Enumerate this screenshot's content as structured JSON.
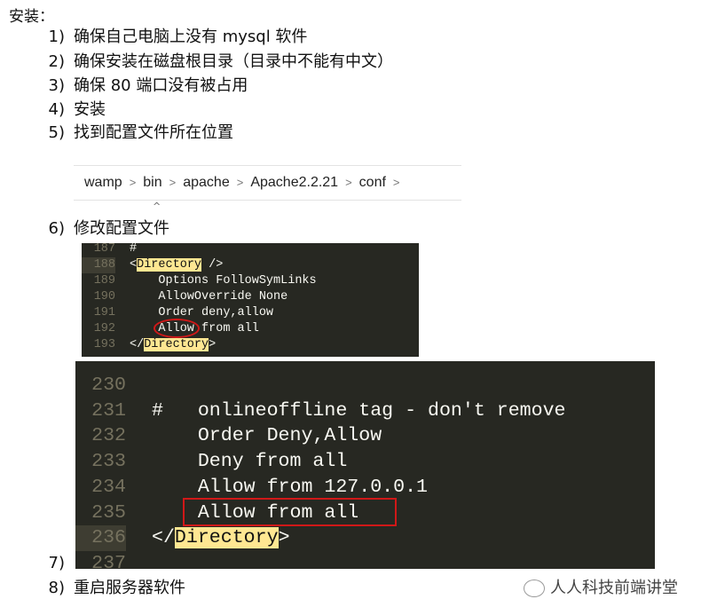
{
  "heading": "安装：",
  "steps": [
    {
      "num": "1)",
      "text": "确保自己电脑上没有 mysql 软件"
    },
    {
      "num": "2)",
      "text": "确保安装在磁盘根目录（目录中不能有中文）"
    },
    {
      "num": "3)",
      "text": "确保 80 端口没有被占用"
    },
    {
      "num": "4)",
      "text": "安装"
    },
    {
      "num": "5)",
      "text": "找到配置文件所在位置"
    },
    {
      "num": "6)",
      "text": "修改配置文件"
    },
    {
      "num": "7)",
      "text": ""
    },
    {
      "num": "8)",
      "text": "重启服务器软件"
    }
  ],
  "breadcrumb": [
    "wamp",
    "bin",
    "apache",
    "Apache2.2.21",
    "conf"
  ],
  "code1": [
    {
      "n": "187",
      "t": "#"
    },
    {
      "n": "188",
      "t": "<",
      "h": "Directory",
      "r": " />"
    },
    {
      "n": "189",
      "t": "    Options FollowSymLinks"
    },
    {
      "n": "190",
      "t": "    AllowOverride None"
    },
    {
      "n": "191",
      "t": "    Order deny,allow"
    },
    {
      "n": "192",
      "t": "    Allow from all"
    },
    {
      "n": "193",
      "t": "</",
      "h": "Directory",
      "r": ">"
    }
  ],
  "code2": [
    {
      "n": "230",
      "t": ""
    },
    {
      "n": "231",
      "t": "#   onlineoffline tag - don't remove"
    },
    {
      "n": "232",
      "t": "    Order Deny,Allow"
    },
    {
      "n": "233",
      "t": "    Deny from all"
    },
    {
      "n": "234",
      "t": "    Allow from 127.0.0.1"
    },
    {
      "n": "235",
      "t": "    Allow from all"
    },
    {
      "n": "236",
      "t": "</",
      "h": "Directory",
      "r": ">"
    },
    {
      "n": "237",
      "t": ""
    }
  ],
  "watermark": "人人科技前端讲堂",
  "colors": {
    "editor_bg": "#272822",
    "highlight": "#ffe792",
    "annotation": "#d01818"
  }
}
